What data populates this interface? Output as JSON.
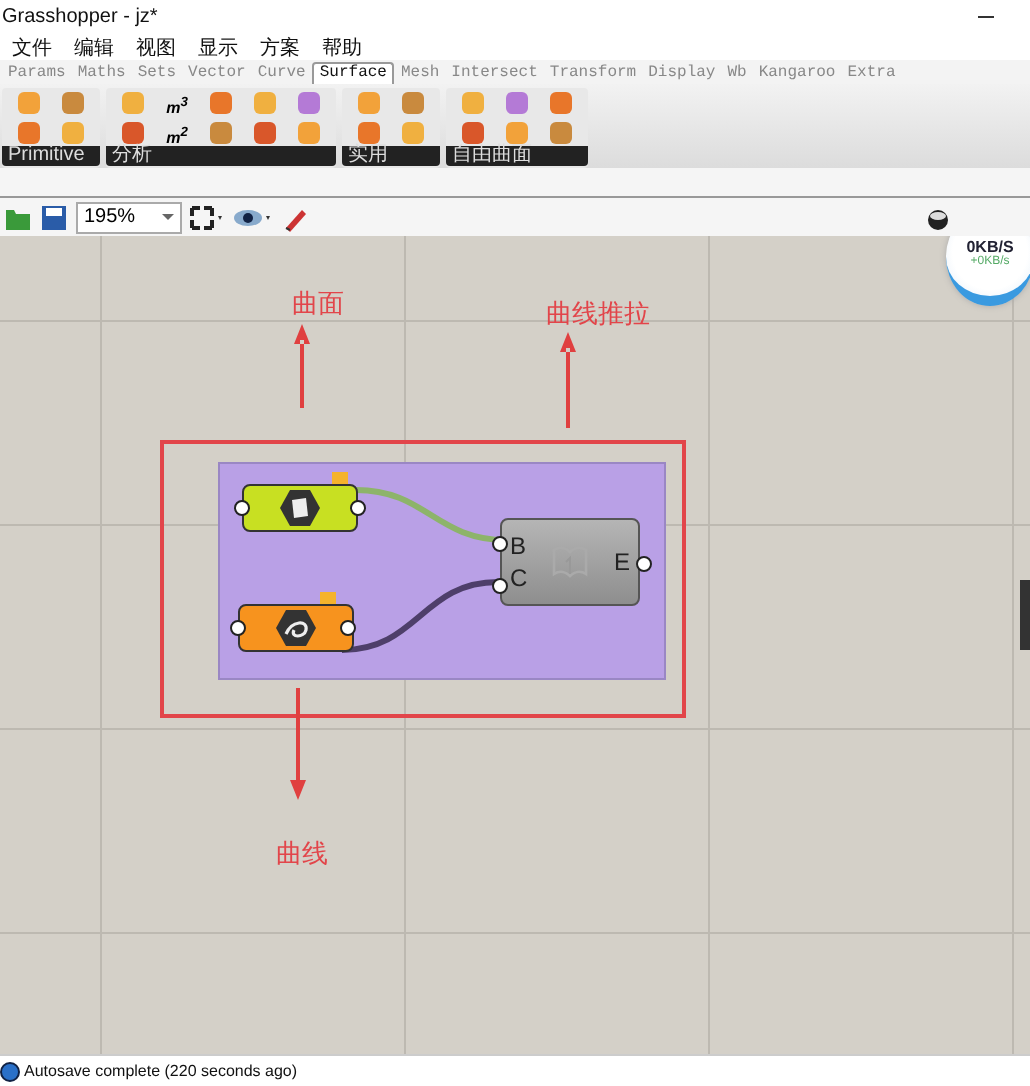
{
  "window": {
    "title": "Grasshopper - jz*"
  },
  "menu": [
    "文件",
    "编辑",
    "视图",
    "显示",
    "方案",
    "帮助"
  ],
  "tabs": [
    {
      "label": "Params",
      "selected": false
    },
    {
      "label": "Maths",
      "selected": false
    },
    {
      "label": "Sets",
      "selected": false
    },
    {
      "label": "Vector",
      "selected": false
    },
    {
      "label": "Curve",
      "selected": false
    },
    {
      "label": "Surface",
      "selected": true
    },
    {
      "label": "Mesh",
      "selected": false
    },
    {
      "label": "Intersect",
      "selected": false
    },
    {
      "label": "Transform",
      "selected": false
    },
    {
      "label": "Display",
      "selected": false
    },
    {
      "label": "Wb",
      "selected": false
    },
    {
      "label": "Kangaroo",
      "selected": false
    },
    {
      "label": "Extra",
      "selected": false
    }
  ],
  "ribbon_groups": [
    {
      "label": "Primitive",
      "columns": [
        [
          {
            "kind": "icon"
          },
          {
            "kind": "icon"
          }
        ],
        [
          {
            "kind": "icon"
          },
          {
            "kind": "icon"
          }
        ]
      ]
    },
    {
      "label": "分析",
      "columns": [
        [
          {
            "kind": "icon"
          },
          {
            "kind": "icon"
          }
        ],
        [
          {
            "kind": "text",
            "text": "m$^{3}$"
          },
          {
            "kind": "text",
            "text": "m$^{2}$"
          }
        ],
        [
          {
            "kind": "icon"
          },
          {
            "kind": "icon"
          }
        ],
        [
          {
            "kind": "icon"
          },
          {
            "kind": "icon"
          }
        ],
        [
          {
            "kind": "icon"
          },
          {
            "kind": "icon"
          }
        ]
      ]
    },
    {
      "label": "实用",
      "columns": [
        [
          {
            "kind": "icon"
          },
          {
            "kind": "icon"
          }
        ],
        [
          {
            "kind": "icon"
          },
          {
            "kind": "icon"
          }
        ]
      ]
    },
    {
      "label": "自由曲面",
      "columns": [
        [
          {
            "kind": "icon"
          },
          {
            "kind": "icon"
          }
        ],
        [
          {
            "kind": "icon"
          },
          {
            "kind": "icon"
          }
        ],
        [
          {
            "kind": "icon"
          },
          {
            "kind": "icon"
          }
        ]
      ]
    }
  ],
  "toolbar": {
    "zoom": "195%"
  },
  "network": {
    "speed": "0KB/S",
    "upload": "+0KB/s"
  },
  "canvas": {
    "annotations": [
      {
        "kind": "label",
        "text": "曲面"
      },
      {
        "kind": "label",
        "text": "曲线推拉"
      },
      {
        "kind": "label",
        "text": "曲线"
      }
    ],
    "nodes": [
      {
        "kind": "surface",
        "color": "#c8e022"
      },
      {
        "kind": "curve",
        "color": "#f7931e"
      }
    ],
    "component": {
      "inputs": [
        "B",
        "C"
      ],
      "outputs": [
        "E"
      ]
    }
  },
  "status_bar": {
    "text": "Autosave complete (220 seconds ago)"
  }
}
